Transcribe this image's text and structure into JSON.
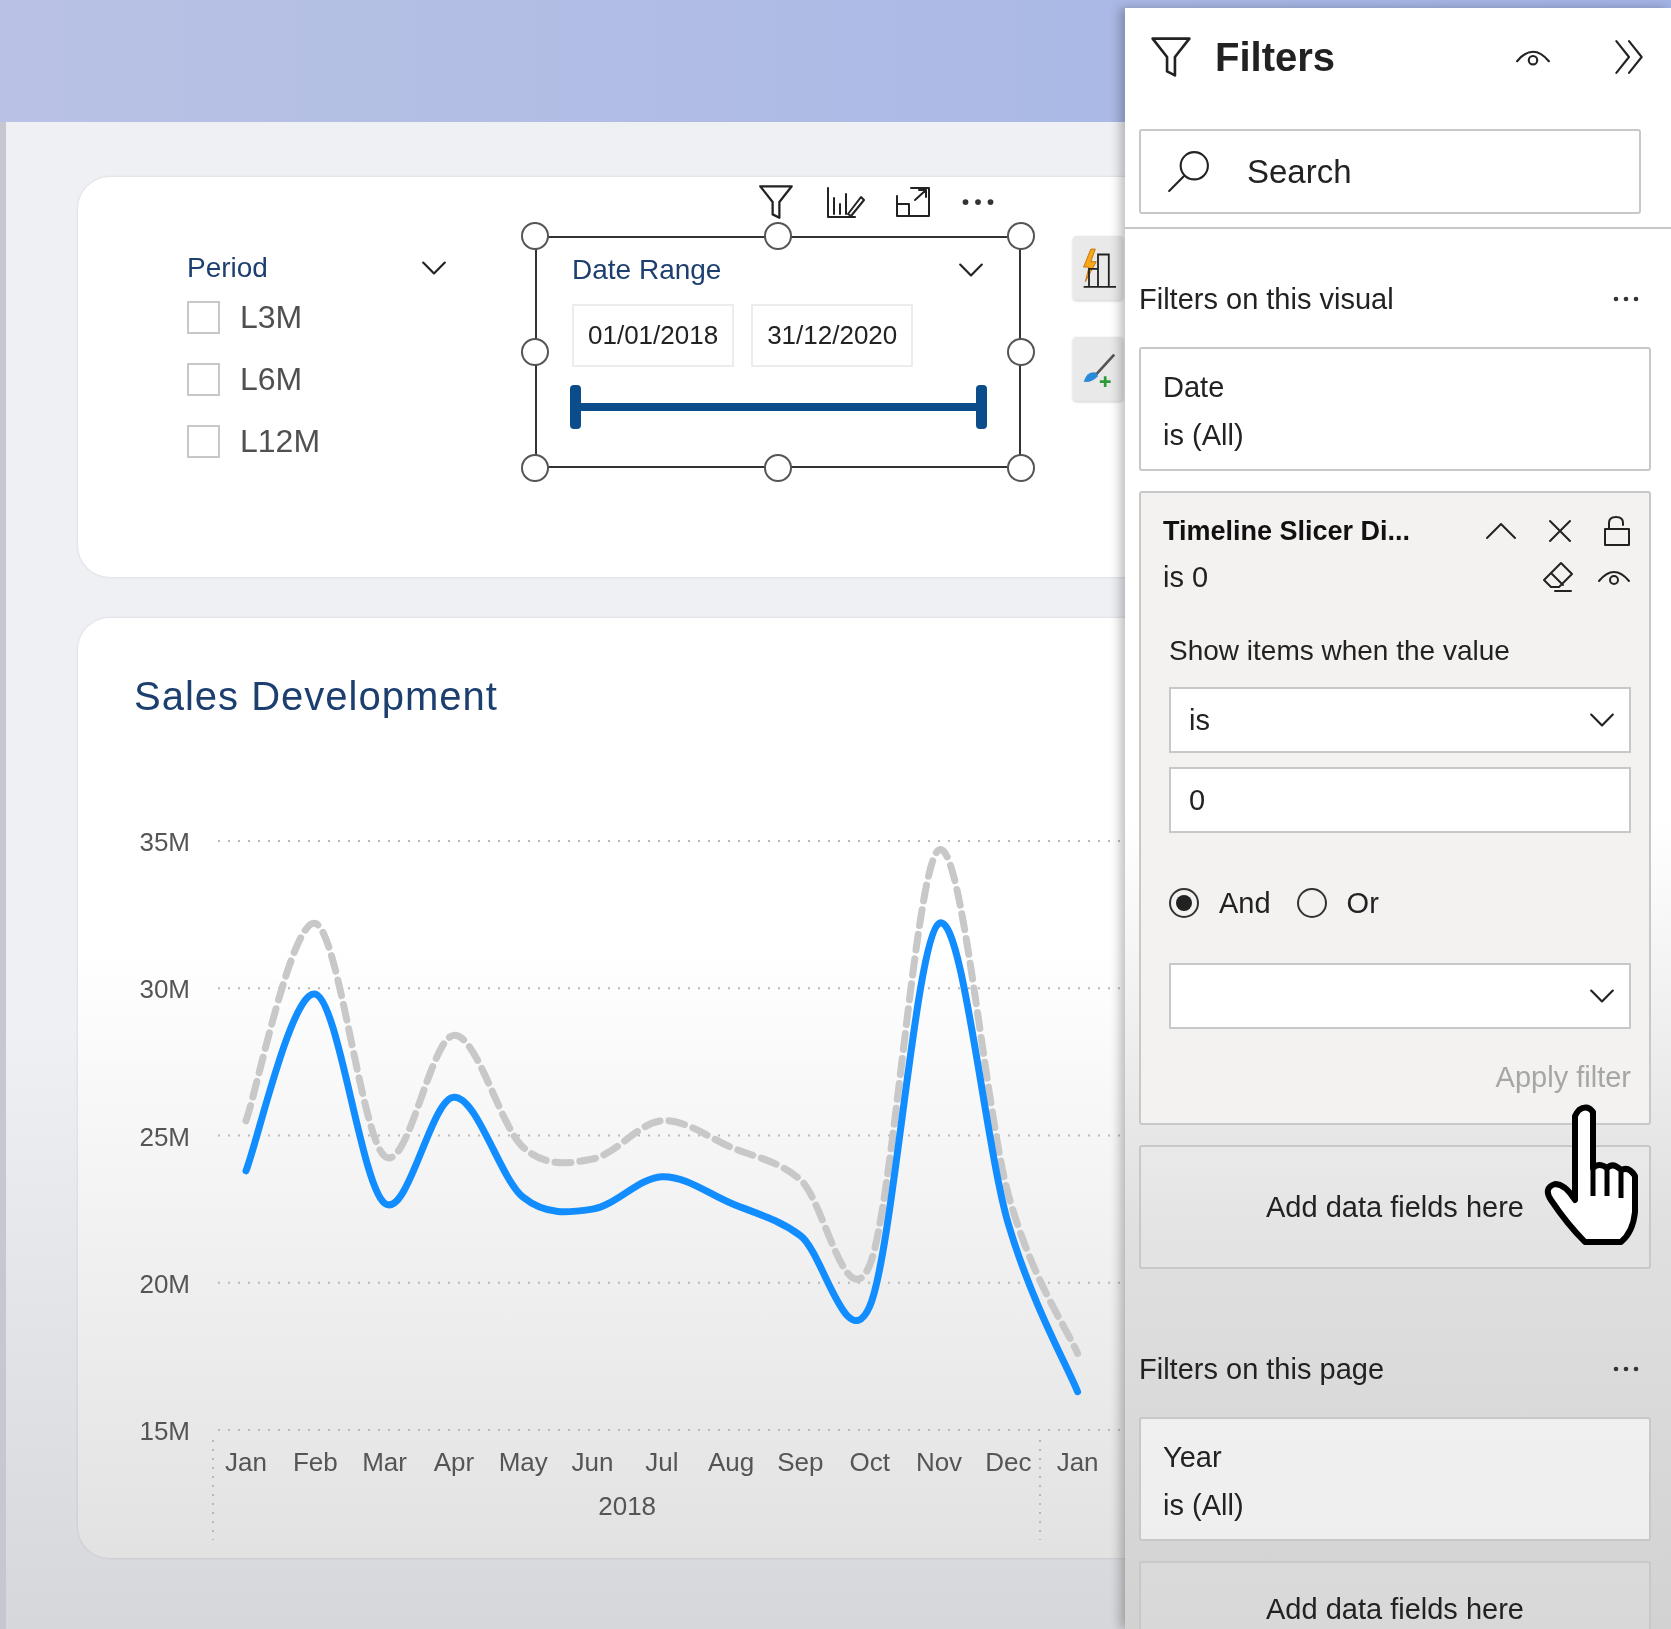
{
  "canvas": {
    "period_slicer": {
      "title": "Period",
      "items": [
        {
          "label": "L3M",
          "checked": false
        },
        {
          "label": "L6M",
          "checked": false
        },
        {
          "label": "L12M",
          "checked": false
        }
      ]
    },
    "date_slicer": {
      "title": "Date Range",
      "start": "01/01/2018",
      "end": "31/12/2020",
      "level": 1,
      "selected": true
    },
    "chart": {
      "title": "Sales Development",
      "chart_data": {
        "type": "line",
        "xlabel": "2018",
        "categories": [
          "Jan",
          "Feb",
          "Mar",
          "Apr",
          "May",
          "Jun",
          "Jul",
          "Aug",
          "Sep",
          "Oct",
          "Nov",
          "Dec",
          "Jan"
        ],
        "ylim": [
          15,
          35
        ],
        "grid": true,
        "yticks": [
          {
            "value": 15,
            "label": "15M"
          },
          {
            "value": 20,
            "label": "20M"
          },
          {
            "value": 25,
            "label": "25M"
          },
          {
            "value": 30,
            "label": "30M"
          },
          {
            "value": 35,
            "label": "35M"
          }
        ],
        "series": [
          {
            "line_style": "dashed",
            "color": "#c8c8c8",
            "values": [
              25.5,
              32.2,
              24.3,
              28.4,
              24.6,
              24.2,
              25.5,
              24.6,
              23.5,
              20.6,
              34.7,
              23.0,
              17.6
            ]
          },
          {
            "line_style": "solid",
            "color": "#118dff",
            "values": [
              23.8,
              29.8,
              22.7,
              26.3,
              22.9,
              22.5,
              23.6,
              22.7,
              21.6,
              19.2,
              32.2,
              22.0,
              16.3
            ]
          }
        ]
      }
    }
  },
  "filters_pane": {
    "title": "Filters",
    "search": {
      "placeholder": "Search"
    },
    "visual_section": {
      "title": "Filters on this visual",
      "filters": [
        {
          "kind": "summary",
          "field": "Date",
          "condition": "is (All)"
        },
        {
          "kind": "expanded",
          "field": "Timeline Slicer Di...",
          "condition": "is 0",
          "prompt": "Show items when the value",
          "operator": "is",
          "value": "0",
          "logic": [
            {
              "label": "And",
              "selected": true
            },
            {
              "label": "Or",
              "selected": false
            }
          ],
          "apply": "Apply filter",
          "disabled": true
        },
        {
          "kind": "drop",
          "text": "Add data fields here"
        }
      ]
    },
    "page_section": {
      "title": "Filters on this page",
      "filters": [
        {
          "kind": "summary",
          "field": "Year",
          "condition": "is (All)"
        },
        {
          "kind": "drop",
          "text": "Add data fields here"
        }
      ]
    }
  }
}
